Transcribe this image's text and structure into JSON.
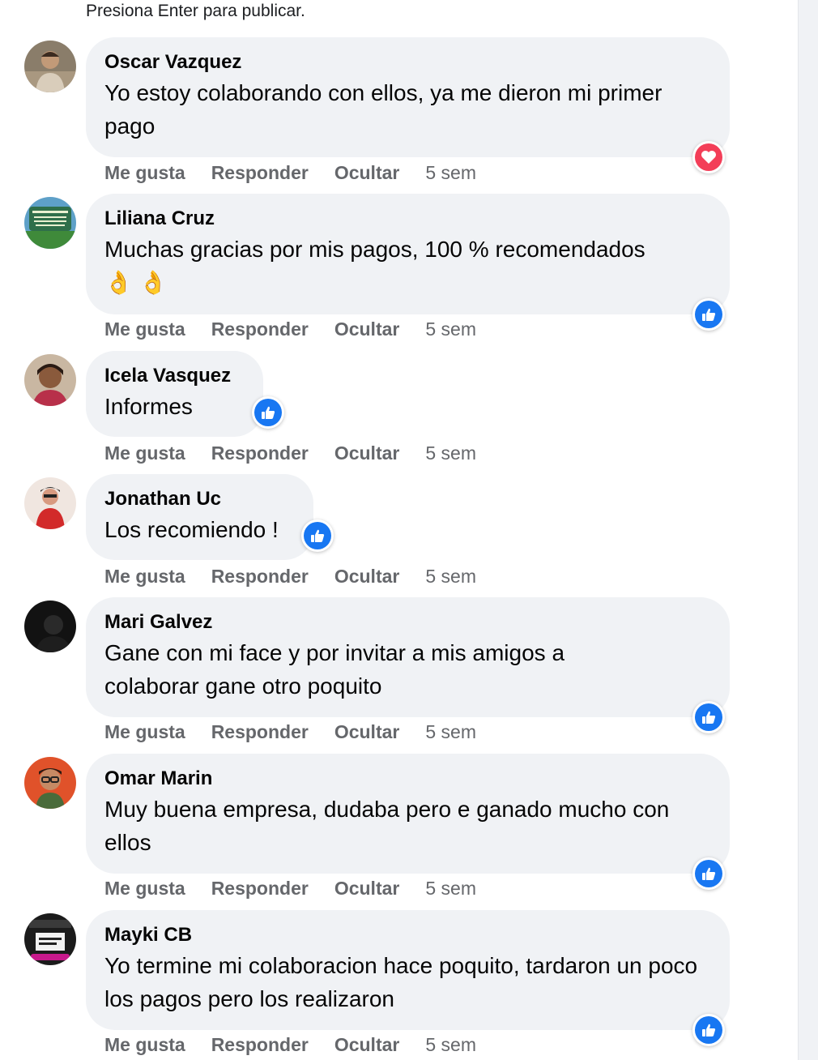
{
  "hint": "Presiona Enter para publicar.",
  "actions": {
    "like": "Me gusta",
    "reply": "Responder",
    "hide": "Ocultar"
  },
  "colors": {
    "bubble": "#f0f2f5",
    "like_blue": "#1877f2",
    "love_red": "#f33e58",
    "meta_gray": "#65676b"
  },
  "comments": [
    {
      "author": "Oscar Vazquez",
      "text": "Yo estoy colaborando con ellos, ya me dieron mi primer pago",
      "time": "5 sem",
      "reaction": "heart-icon"
    },
    {
      "author": "Liliana Cruz",
      "text": "Muchas gracias por mis pagos, 100 % recomendados",
      "emoji": "👌 👌",
      "time": "5 sem",
      "reaction": "like-icon"
    },
    {
      "author": "Icela Vasquez",
      "text": "Informes",
      "time": "5 sem",
      "reaction": "like-icon"
    },
    {
      "author": "Jonathan Uc",
      "text": "Los recomiendo !",
      "time": "5 sem",
      "reaction": "like-icon"
    },
    {
      "author": "Mari Galvez",
      "text": "Gane con mi face y por invitar a mis amigos a colaborar gane otro poquito",
      "time": "5 sem",
      "reaction": "like-icon"
    },
    {
      "author": "Omar Marin",
      "text": "Muy buena empresa, dudaba pero e ganado mucho con ellos",
      "time": "5 sem",
      "reaction": "like-icon"
    },
    {
      "author": "Mayki CB",
      "text": "Yo termine mi colaboracion hace poquito, tardaron un poco los pagos pero los realizaron",
      "time": "5 sem",
      "reaction": "like-icon"
    }
  ]
}
